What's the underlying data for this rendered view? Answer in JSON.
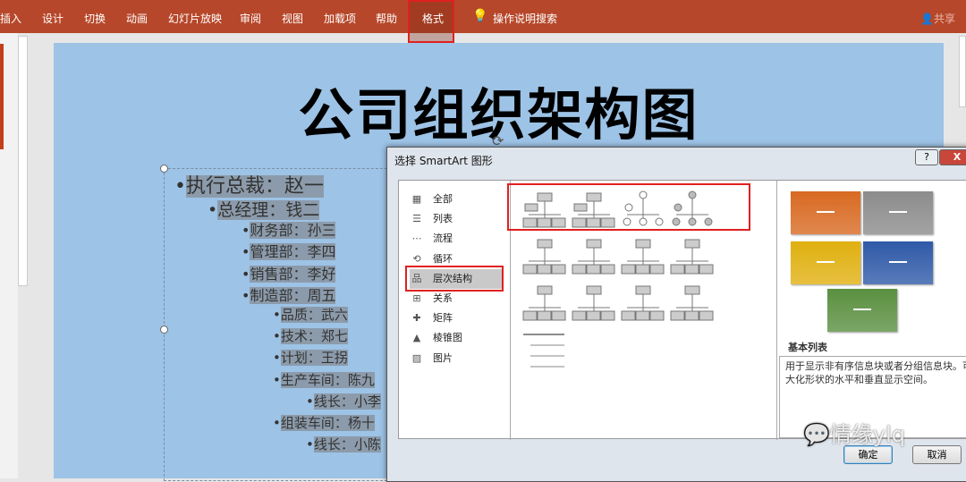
{
  "ribbon": {
    "tabs": [
      "插入",
      "设计",
      "切换",
      "动画",
      "幻灯片放映",
      "审阅",
      "视图",
      "加载项",
      "帮助",
      "格式"
    ],
    "search": "操作说明搜索",
    "share": "共享"
  },
  "slide": {
    "title": "公司组织架构图",
    "items": [
      {
        "text": "执行总裁：赵一",
        "level": 0
      },
      {
        "text": "总经理：钱二",
        "level": 1
      },
      {
        "text": "财务部：孙三",
        "level": 2
      },
      {
        "text": "管理部：李四",
        "level": 2
      },
      {
        "text": "销售部：李好",
        "level": 2
      },
      {
        "text": "制造部：周五",
        "level": 2
      },
      {
        "text": "品质：武六",
        "level": 3
      },
      {
        "text": "技术：郑七",
        "level": 3
      },
      {
        "text": "计划：王拐",
        "level": 3
      },
      {
        "text": "生产车间：陈九",
        "level": 3
      },
      {
        "text": "线长：小李",
        "level": 4
      },
      {
        "text": "组装车间：杨十",
        "level": 3
      },
      {
        "text": "线长：小陈",
        "level": 4
      }
    ]
  },
  "dialog": {
    "title": "选择 SmartArt 图形",
    "help": "?",
    "close": "X",
    "categories": [
      "全部",
      "列表",
      "流程",
      "循环",
      "层次结构",
      "关系",
      "矩阵",
      "棱锥图",
      "图片"
    ],
    "selected_category": "层次结构",
    "preview_name": "基本列表",
    "preview_desc": "用于显示非有序信息块或者分组信息块。可最大化形状的水平和垂直显示空间。",
    "ok": "确定",
    "cancel": "取消",
    "swatch_colors": [
      "#d86a22",
      "#8c8c8c",
      "#e0b010",
      "#2f5aa8",
      "#5a9040"
    ]
  },
  "watermark": "情缘ylq"
}
